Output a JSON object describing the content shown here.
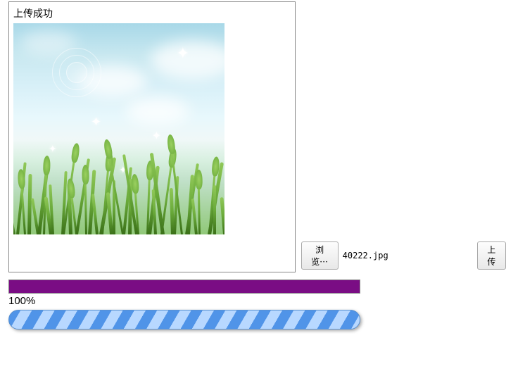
{
  "preview": {
    "status_text": "上传成功"
  },
  "controls": {
    "browse_button_label": "浏览⋯",
    "filename": "40222.jpg",
    "upload_button_label": "上传"
  },
  "progress": {
    "percent_label": "100%",
    "percent_value": 100
  }
}
